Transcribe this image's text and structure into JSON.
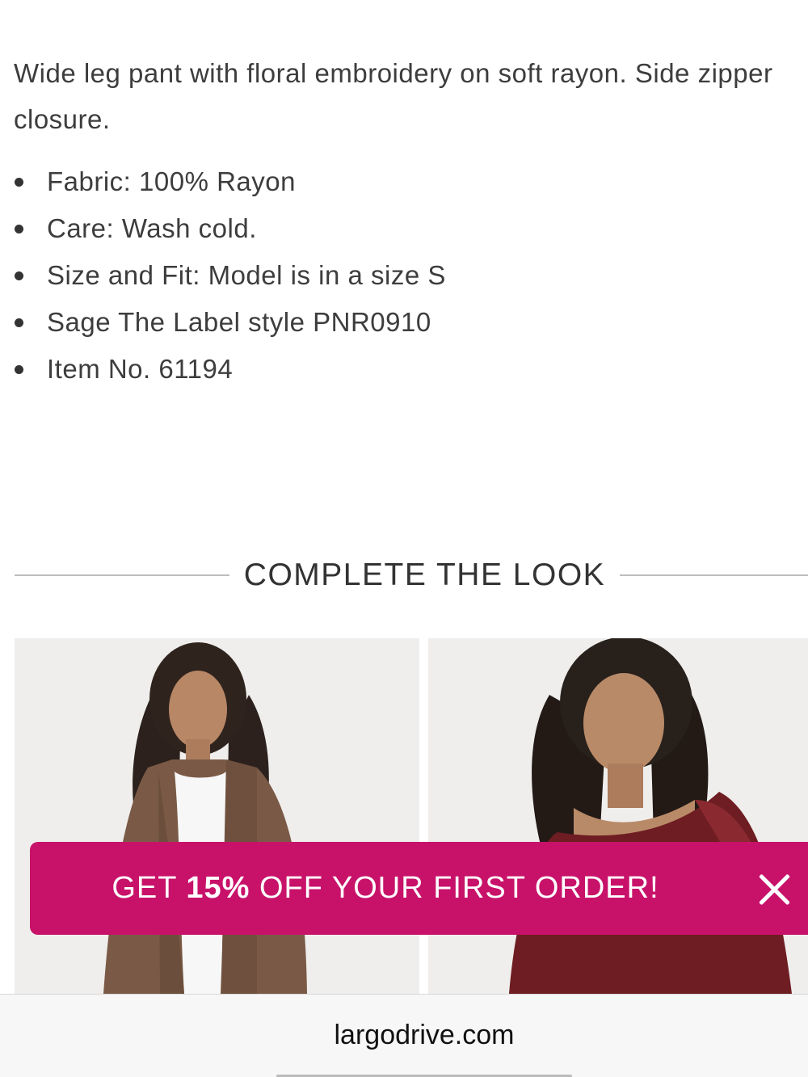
{
  "product": {
    "description": "Wide leg pant with floral embroidery on soft rayon. Side zipper closure.",
    "specs": [
      "Fabric: 100% Rayon",
      "Care: Wash cold.",
      "Size and Fit: Model is in a size S",
      "Sage The Label style PNR0910",
      "Item No. 61194"
    ]
  },
  "complete_the_look": {
    "title": "COMPLETE THE LOOK",
    "items": [
      {
        "image_alt": "model-wearing-brown-fuzzy-cardigan"
      },
      {
        "image_alt": "model-wearing-burgundy-open-knit-sweater"
      }
    ]
  },
  "promo": {
    "text_before": "GET ",
    "text_bold": "15%",
    "text_after": " OFF YOUR FIRST ORDER!",
    "background_color": "#c8126a",
    "close_icon": "close-icon"
  },
  "browser": {
    "url": "largodrive.com"
  }
}
